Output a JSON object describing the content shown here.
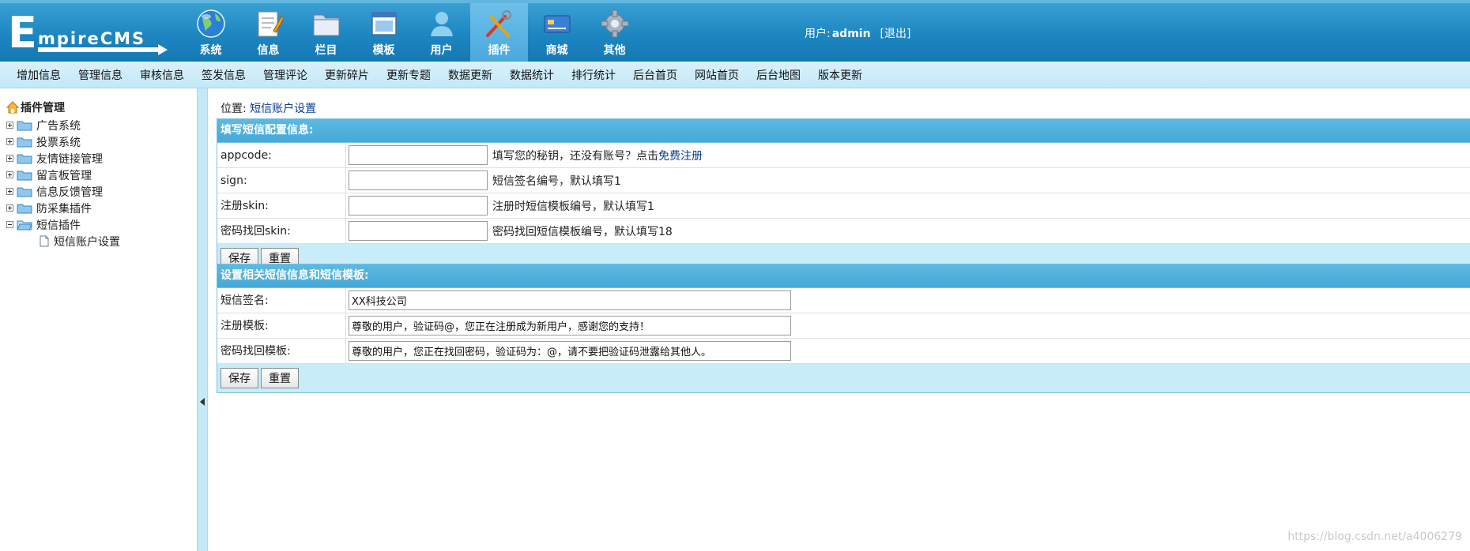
{
  "header": {
    "logo_text": "EmpireCMS",
    "nav": [
      {
        "label": "系统",
        "icon": "globe-icon"
      },
      {
        "label": "信息",
        "icon": "notepad-icon"
      },
      {
        "label": "栏目",
        "icon": "folder-icon"
      },
      {
        "label": "模板",
        "icon": "template-window-icon"
      },
      {
        "label": "用户",
        "icon": "user-icon"
      },
      {
        "label": "插件",
        "icon": "tools-icon",
        "active": true
      },
      {
        "label": "商城",
        "icon": "credit-card-icon"
      },
      {
        "label": "其他",
        "icon": "gear-icon"
      }
    ],
    "user_prefix": "用户:",
    "username": "admin",
    "logout": "[退出]"
  },
  "submenu": [
    "增加信息",
    "管理信息",
    "审核信息",
    "签发信息",
    "管理评论",
    "更新碎片",
    "更新专题",
    "数据更新",
    "数据统计",
    "排行统计",
    "后台首页",
    "网站首页",
    "后台地图",
    "版本更新"
  ],
  "tree": {
    "root": "插件管理",
    "items": [
      {
        "label": "广告系统",
        "expanded": false
      },
      {
        "label": "投票系统",
        "expanded": false
      },
      {
        "label": "友情链接管理",
        "expanded": false
      },
      {
        "label": "留言板管理",
        "expanded": false
      },
      {
        "label": "信息反馈管理",
        "expanded": false
      },
      {
        "label": "防采集插件",
        "expanded": false
      },
      {
        "label": "短信插件",
        "expanded": true
      }
    ],
    "child": "短信账户设置"
  },
  "breadcrumb": {
    "prefix": "位置:",
    "link": "短信账户设置"
  },
  "config_panel": {
    "title": "填写短信配置信息:",
    "rows": [
      {
        "label": "appcode:",
        "value": "",
        "hint": "填写您的秘钥，还没有账号？点击",
        "hint_link": "免费注册"
      },
      {
        "label": "sign:",
        "value": "",
        "hint": "短信签名编号，默认填写1"
      },
      {
        "label": "注册skin:",
        "value": "",
        "hint": "注册时短信模板编号，默认填写1"
      },
      {
        "label": "密码找回skin:",
        "value": "",
        "hint": "密码找回短信模板编号，默认填写18"
      }
    ],
    "save": "保存",
    "reset": "重置"
  },
  "template_panel": {
    "title": "设置相关短信信息和短信模板:",
    "rows": [
      {
        "label": "短信签名:",
        "value": "XX科技公司"
      },
      {
        "label": "注册模板:",
        "value": "尊敬的用户，验证码@，您正在注册成为新用户，感谢您的支持！"
      },
      {
        "label": "密码找回模板:",
        "value": "尊敬的用户，您正在找回密码，验证码为：@，请不要把验证码泄露给其他人。"
      }
    ],
    "save": "保存",
    "reset": "重置"
  },
  "watermark": "https://blog.csdn.net/a4006279",
  "colors": {
    "header": "#1d86c1",
    "submenu": "#c3e8f7",
    "panel_head": "#45a9d8",
    "link": "#0a3d91"
  }
}
